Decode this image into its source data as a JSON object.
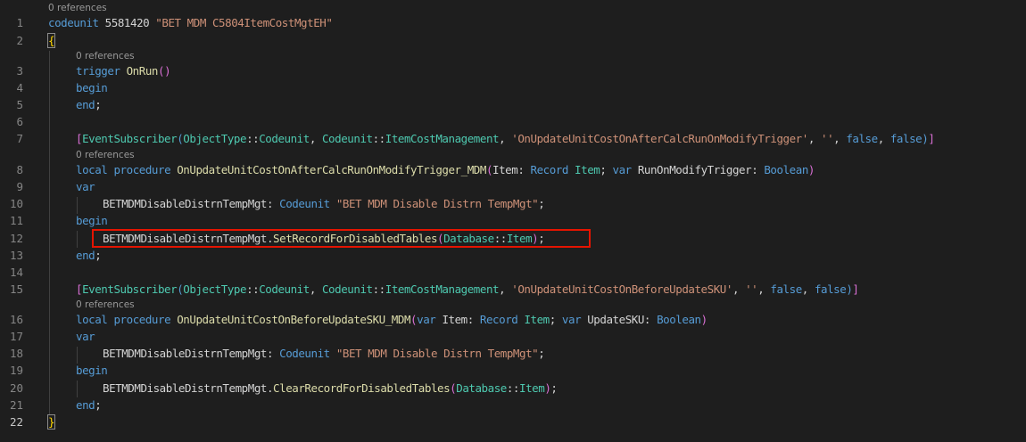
{
  "colors": {
    "background": "#1e1e1e",
    "keyword": "#569cd6",
    "function": "#dcdcaa",
    "type": "#4ec9b0",
    "string": "#ce9178",
    "variable": "#9cdcfe",
    "line_number": "#858585",
    "codelens": "#999999",
    "highlight_border": "#e51400"
  },
  "codelens": {
    "text": "0 references"
  },
  "line_numbers": [
    "1",
    "2",
    "3",
    "4",
    "5",
    "6",
    "7",
    "8",
    "9",
    "10",
    "11",
    "12",
    "13",
    "14",
    "15",
    "16",
    "17",
    "18",
    "19",
    "20",
    "21",
    "22"
  ],
  "tokens": {
    "codeunit": "codeunit",
    "codeunit_id": " 5581420 ",
    "codeunit_name": "\"BET MDM C5804ItemCostMgtEH\"",
    "open_brace": "{",
    "close_brace": "}",
    "trigger": "trigger",
    "on_run": "OnRun",
    "paren_open": "(",
    "paren_close": ")",
    "begin": "begin",
    "end": "end",
    "semicolon": ";",
    "end_semicolon": "end;",
    "var": "var",
    "local": "local",
    "procedure": "procedure",
    "event_subscriber": "EventSubscriber",
    "object_type": "ObjectType",
    "codeunit_enum": "Codeunit",
    "double_colon": "::",
    "item_cost_mgmt": "ItemCostManagement",
    "comma_space": ", ",
    "sq_bracket_open": "[",
    "sq_bracket_close": "]",
    "event1": "'OnUpdateUnitCostOnAfterCalcRunOnModifyTrigger'",
    "event2": "'OnUpdateUnitCostOnBeforeUpdateSKU'",
    "empty_str": "''",
    "false": "false",
    "proc1": "OnUpdateUnitCostOnAfterCalcRunOnModifyTrigger_MDM",
    "proc2": "OnUpdateUnitCostOnBeforeUpdateSKU_MDM",
    "item": "Item",
    "colon_space": ": ",
    "record": "Record",
    "semi_space": "; ",
    "run_on_modify_trigger": "RunOnModifyTrigger",
    "update_sku": "UpdateSKU",
    "boolean": "Boolean",
    "mgt_var": "BETMDMDisableDistrnTempMgt",
    "mgt_codeunit_name": "\"BET MDM Disable Distrn TempMgt\"",
    "mgt_codeunit_name2": "\"BET MDM Disable Distrn TempMgt\"",
    "dot": ".",
    "set_record": "SetRecordForDisabledTables",
    "clear_record": "ClearRecordForDisabledTables",
    "database": "Database",
    "space": " "
  }
}
